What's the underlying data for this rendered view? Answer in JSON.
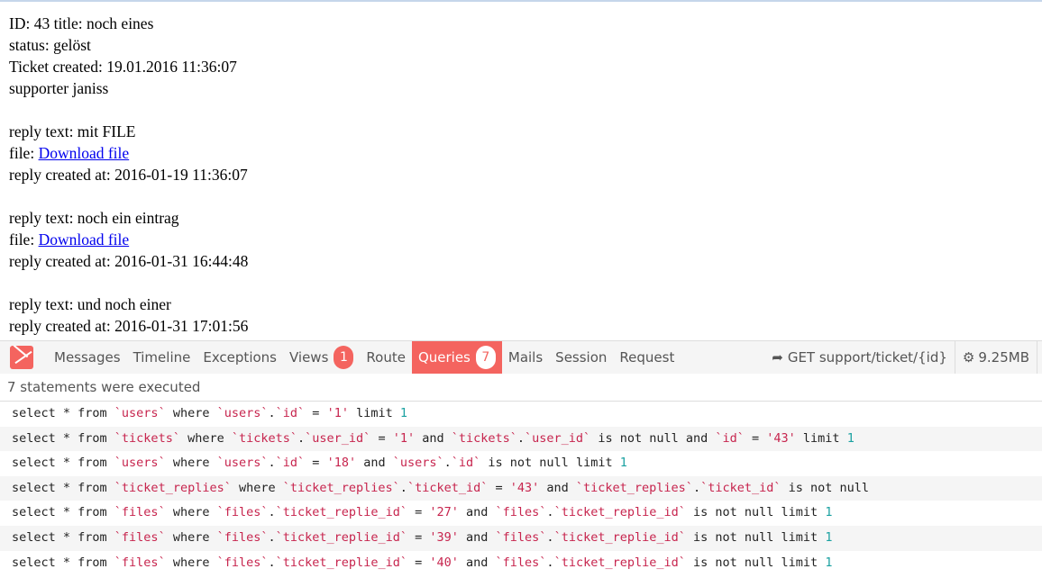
{
  "ticket": {
    "line1": "ID: 43 title: noch eines",
    "status": "status: gelöst",
    "created": "Ticket created: 19.01.2016 11:36:07",
    "supporter": "supporter janiss"
  },
  "replies": [
    {
      "text": "reply text: mit FILE",
      "file_label": "file: ",
      "file_link": "Download file",
      "created": "reply created at: 2016-01-19 11:36:07"
    },
    {
      "text": "reply text: noch ein eintrag",
      "file_label": "file: ",
      "file_link": "Download file",
      "created": "reply created at: 2016-01-31 16:44:48"
    },
    {
      "text": "reply text: und noch einer",
      "created": "reply created at: 2016-01-31 17:01:56"
    }
  ],
  "debugbar": {
    "tabs": [
      {
        "label": "Messages"
      },
      {
        "label": "Timeline"
      },
      {
        "label": "Exceptions"
      },
      {
        "label": "Views",
        "badge": "1"
      },
      {
        "label": "Route"
      },
      {
        "label": "Queries",
        "badge": "7",
        "active": true
      },
      {
        "label": "Mails"
      },
      {
        "label": "Session"
      },
      {
        "label": "Request"
      }
    ],
    "route": "GET support/ticket/{id}",
    "memory": "9.25MB",
    "accent": "#f4645f",
    "status": "7 statements were executed",
    "queries": [
      [
        [
          "p",
          "select * from "
        ],
        [
          "id",
          "`users`"
        ],
        [
          "p",
          " where "
        ],
        [
          "id",
          "`users`"
        ],
        [
          "p",
          "."
        ],
        [
          "id",
          "`id`"
        ],
        [
          "p",
          " = "
        ],
        [
          "str",
          "'1'"
        ],
        [
          "p",
          " limit "
        ],
        [
          "num",
          "1"
        ]
      ],
      [
        [
          "p",
          "select * from "
        ],
        [
          "id",
          "`tickets`"
        ],
        [
          "p",
          " where "
        ],
        [
          "id",
          "`tickets`"
        ],
        [
          "p",
          "."
        ],
        [
          "id",
          "`user_id`"
        ],
        [
          "p",
          " = "
        ],
        [
          "str",
          "'1'"
        ],
        [
          "p",
          " and "
        ],
        [
          "id",
          "`tickets`"
        ],
        [
          "p",
          "."
        ],
        [
          "id",
          "`user_id`"
        ],
        [
          "p",
          " is not null and "
        ],
        [
          "id",
          "`id`"
        ],
        [
          "p",
          " = "
        ],
        [
          "str",
          "'43'"
        ],
        [
          "p",
          " limit "
        ],
        [
          "num",
          "1"
        ]
      ],
      [
        [
          "p",
          "select * from "
        ],
        [
          "id",
          "`users`"
        ],
        [
          "p",
          " where "
        ],
        [
          "id",
          "`users`"
        ],
        [
          "p",
          "."
        ],
        [
          "id",
          "`id`"
        ],
        [
          "p",
          " = "
        ],
        [
          "str",
          "'18'"
        ],
        [
          "p",
          " and "
        ],
        [
          "id",
          "`users`"
        ],
        [
          "p",
          "."
        ],
        [
          "id",
          "`id`"
        ],
        [
          "p",
          " is not null limit "
        ],
        [
          "num",
          "1"
        ]
      ],
      [
        [
          "p",
          "select * from "
        ],
        [
          "id",
          "`ticket_replies`"
        ],
        [
          "p",
          " where "
        ],
        [
          "id",
          "`ticket_replies`"
        ],
        [
          "p",
          "."
        ],
        [
          "id",
          "`ticket_id`"
        ],
        [
          "p",
          " = "
        ],
        [
          "str",
          "'43'"
        ],
        [
          "p",
          " and "
        ],
        [
          "id",
          "`ticket_replies`"
        ],
        [
          "p",
          "."
        ],
        [
          "id",
          "`ticket_id`"
        ],
        [
          "p",
          " is not null"
        ]
      ],
      [
        [
          "p",
          "select * from "
        ],
        [
          "id",
          "`files`"
        ],
        [
          "p",
          " where "
        ],
        [
          "id",
          "`files`"
        ],
        [
          "p",
          "."
        ],
        [
          "id",
          "`ticket_replie_id`"
        ],
        [
          "p",
          " = "
        ],
        [
          "str",
          "'27'"
        ],
        [
          "p",
          " and "
        ],
        [
          "id",
          "`files`"
        ],
        [
          "p",
          "."
        ],
        [
          "id",
          "`ticket_replie_id`"
        ],
        [
          "p",
          " is not null limit "
        ],
        [
          "num",
          "1"
        ]
      ],
      [
        [
          "p",
          "select * from "
        ],
        [
          "id",
          "`files`"
        ],
        [
          "p",
          " where "
        ],
        [
          "id",
          "`files`"
        ],
        [
          "p",
          "."
        ],
        [
          "id",
          "`ticket_replie_id`"
        ],
        [
          "p",
          " = "
        ],
        [
          "str",
          "'39'"
        ],
        [
          "p",
          " and "
        ],
        [
          "id",
          "`files`"
        ],
        [
          "p",
          "."
        ],
        [
          "id",
          "`ticket_replie_id`"
        ],
        [
          "p",
          " is not null limit "
        ],
        [
          "num",
          "1"
        ]
      ],
      [
        [
          "p",
          "select * from "
        ],
        [
          "id",
          "`files`"
        ],
        [
          "p",
          " where "
        ],
        [
          "id",
          "`files`"
        ],
        [
          "p",
          "."
        ],
        [
          "id",
          "`ticket_replie_id`"
        ],
        [
          "p",
          " = "
        ],
        [
          "str",
          "'40'"
        ],
        [
          "p",
          " and "
        ],
        [
          "id",
          "`files`"
        ],
        [
          "p",
          "."
        ],
        [
          "id",
          "`ticket_replie_id`"
        ],
        [
          "p",
          " is not null limit "
        ],
        [
          "num",
          "1"
        ]
      ]
    ]
  }
}
